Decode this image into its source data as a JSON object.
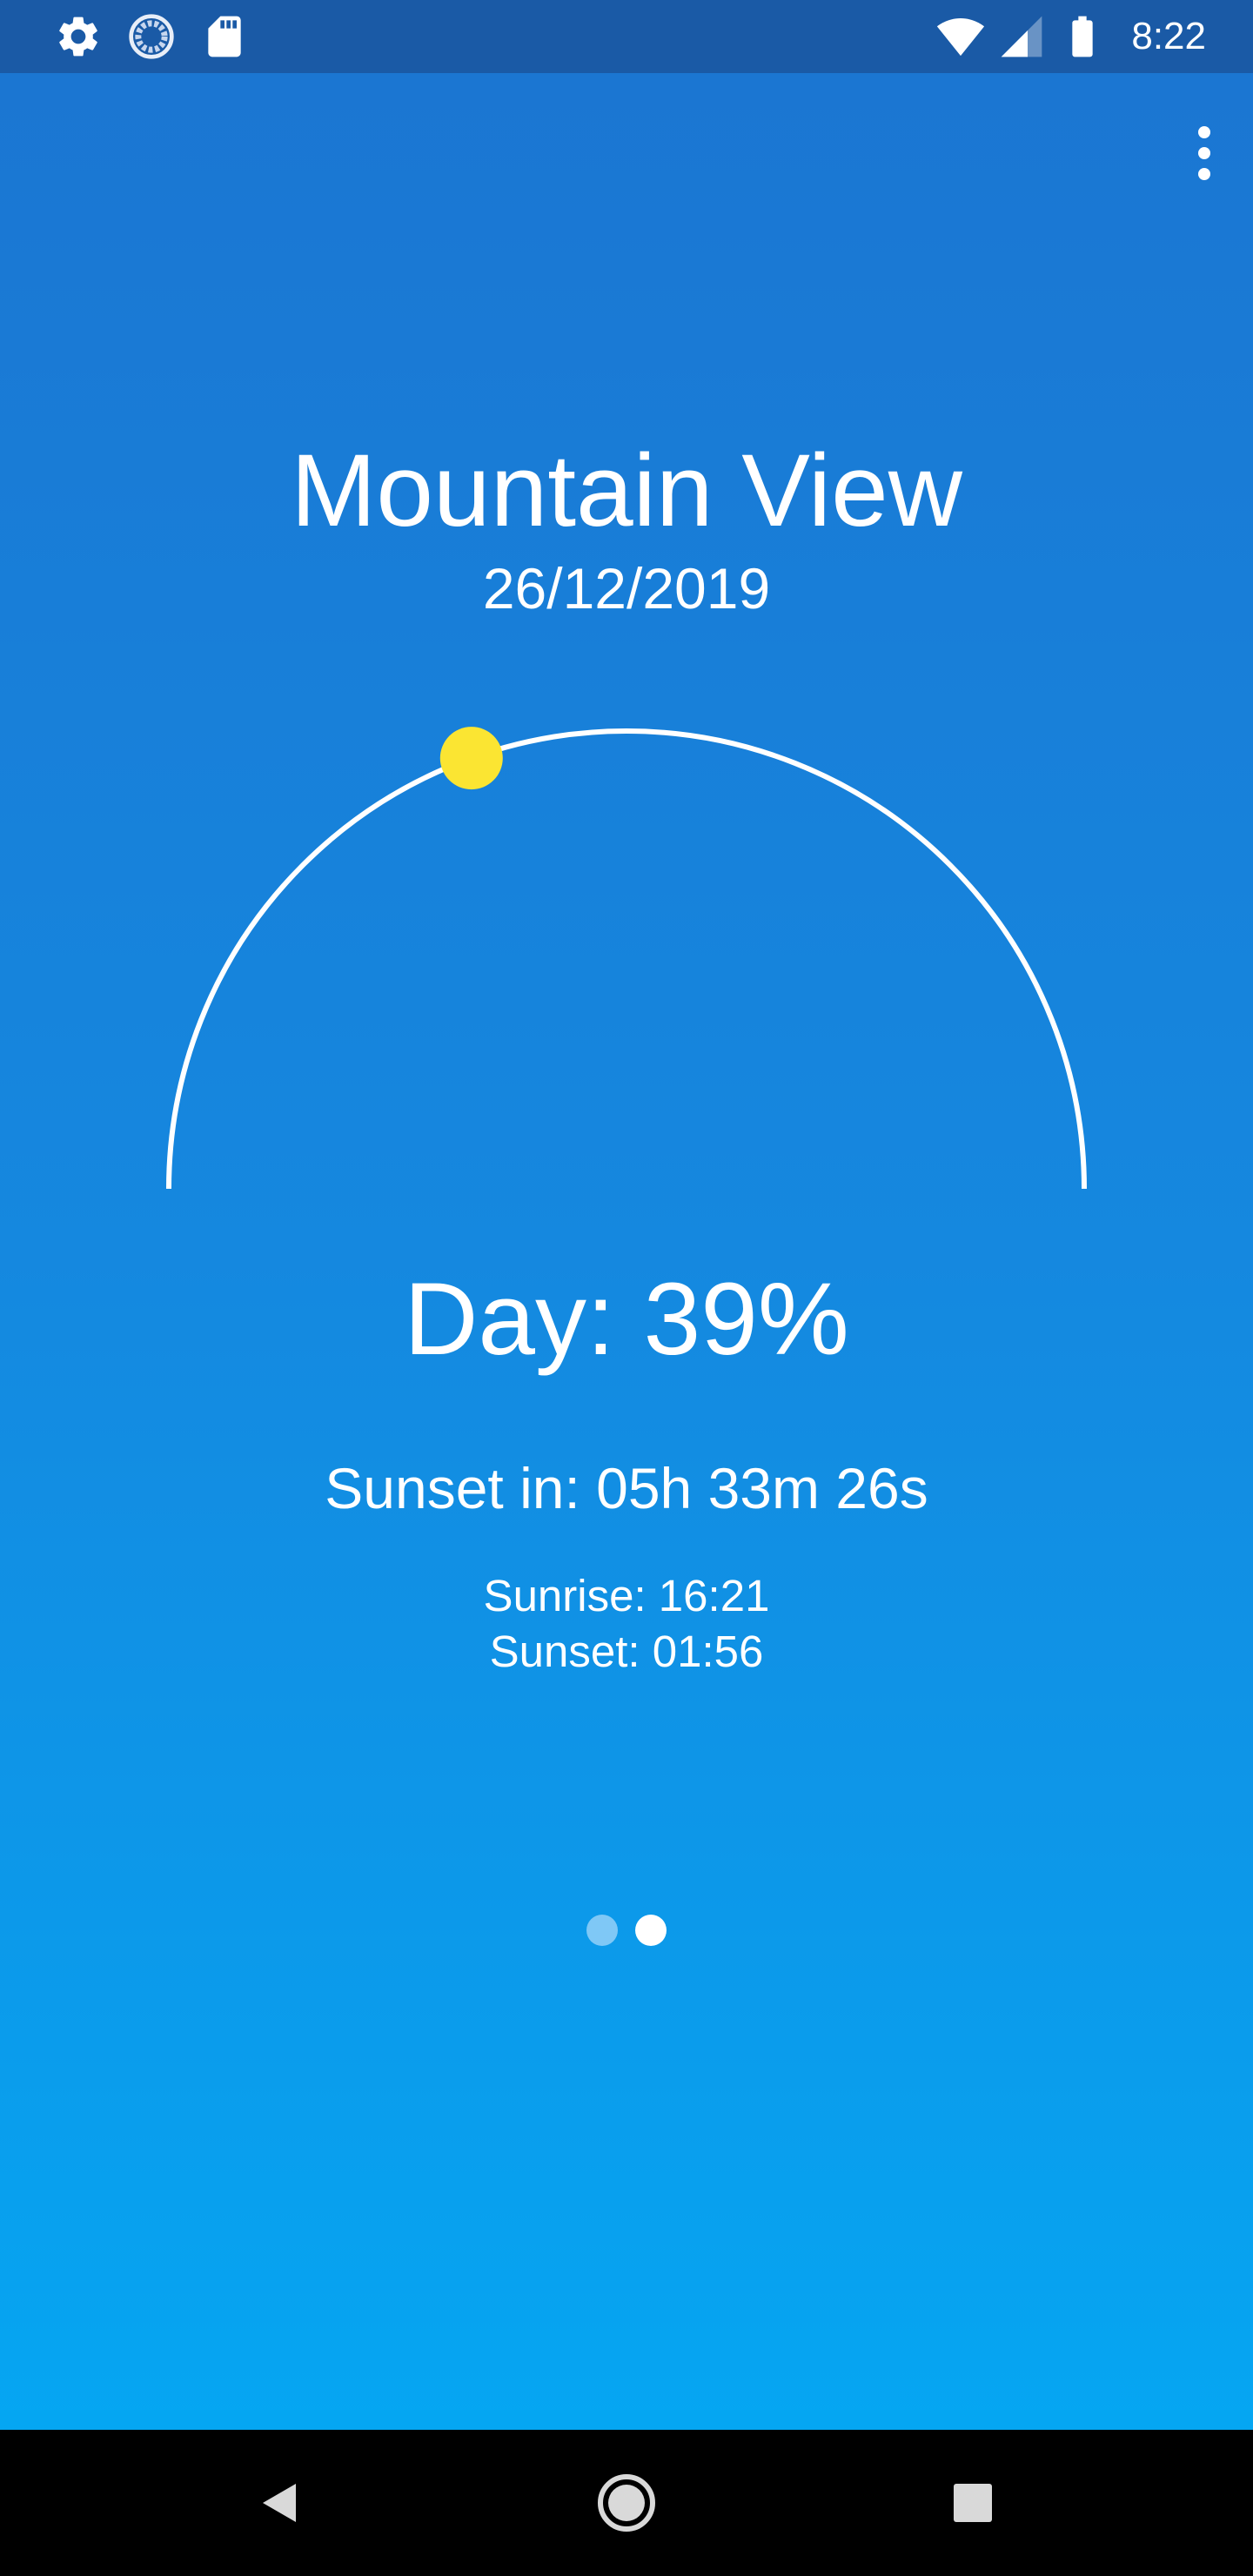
{
  "status_bar": {
    "time": "8:22",
    "left_icons": [
      "settings-icon",
      "sync-icon",
      "sd-card-icon"
    ],
    "right_icons": [
      "wifi-icon",
      "cell-signal-icon",
      "battery-icon"
    ]
  },
  "app": {
    "menu_icon": "more-vert-icon",
    "city": "Mountain View",
    "date": "26/12/2019",
    "day_progress": 0.39,
    "day_label": "Day: 39%",
    "sunset_countdown": "Sunset in: 05h 33m 26s",
    "sunrise": "Sunrise: 16:21",
    "sunset": "Sunset: 01:56",
    "pager": {
      "count": 2,
      "active_index": 1
    },
    "colors": {
      "gradient_top": "#1b76d2",
      "gradient_bottom": "#05a6f2",
      "sun": "#fbe532",
      "arc": "#ffffff"
    }
  },
  "nav_bar": {
    "buttons": [
      "back-icon",
      "home-icon",
      "recents-icon"
    ]
  }
}
